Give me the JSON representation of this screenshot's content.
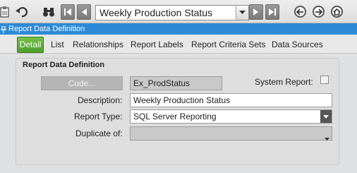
{
  "toolbar": {
    "report_selector_value": "Weekly Production Status"
  },
  "window": {
    "title": "Report Data Definition"
  },
  "tabs": [
    {
      "label": "Detail"
    },
    {
      "label": "List"
    },
    {
      "label": "Relationships"
    },
    {
      "label": "Report Labels"
    },
    {
      "label": "Report Criteria Sets"
    },
    {
      "label": "Data Sources"
    }
  ],
  "form": {
    "section_title": "Report Data Definition",
    "code_button_label": "Code...",
    "code_value": "Ex_ProdStatus",
    "system_report_label": "System Report:",
    "description_label": "Description:",
    "description_value": "Weekly Production Status",
    "report_type_label": "Report Type:",
    "report_type_value": "SQL Server Reporting",
    "duplicate_of_label": "Duplicate of:",
    "duplicate_of_value": ""
  },
  "colors": {
    "accent": "#2d8ad6",
    "tab_active": "#5aa836"
  }
}
